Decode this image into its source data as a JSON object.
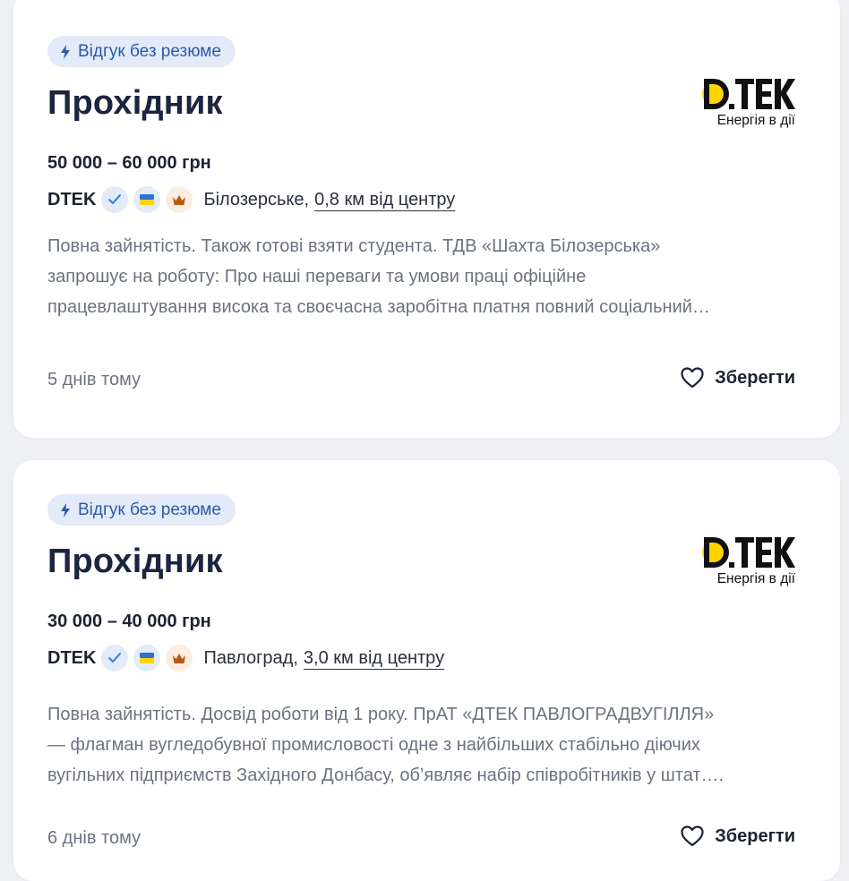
{
  "listings": [
    {
      "badge": "Відгук без резюме",
      "title": "Прохідник",
      "salary": "50 000 – 60 000 грн",
      "company": "DTEK",
      "city": "Білозерське,",
      "distance": "0,8 км від центру",
      "description": [
        "Повна зайнятість. Також готові взяти студента. ТДВ «Шахта Білозерська»",
        "запрошує на роботу: Про наші переваги та умови праці офіційне",
        "працевлаштування висока та своєчасна заробітна платня повний соціальний…"
      ],
      "posted": "5 днів тому",
      "save_label": "Зберегти",
      "logo_text": "D.TEK",
      "logo_tagline": "Енергія в дії"
    },
    {
      "badge": "Відгук без резюме",
      "title": "Прохідник",
      "salary": "30 000 – 40 000 грн",
      "company": "DTEK",
      "city": "Павлоград,",
      "distance": "3,0 км від центру",
      "description": [
        "Повна зайнятість. Досвід роботи від 1 року. ПрАТ «ДТЕК ПАВЛОГРАДВУГІЛЛЯ»",
        "— флагман вугледобувної промисловості одне з найбільших стабільно діючих",
        "вугільних підприємств Західного Донбасу, об’являє набір співробітників у штат…."
      ],
      "posted": "6 днів тому",
      "save_label": "Зберегти",
      "logo_text": "D.TEK",
      "logo_tagline": "Енергія в дії"
    }
  ],
  "colors": {
    "background": "#eef0f4",
    "card": "#ffffff",
    "badge_bg": "#e3ebf8",
    "badge_text": "#2c5aa8",
    "title": "#1b2540",
    "muted_text": "#6c7280",
    "logo_yellow": "#ffd400"
  },
  "icons": {
    "badge": "lightning-icon",
    "verified": "check-icon",
    "ukraine": "ukraine-flag-icon",
    "top_employer": "crown-icon",
    "save": "heart-outline-icon"
  }
}
